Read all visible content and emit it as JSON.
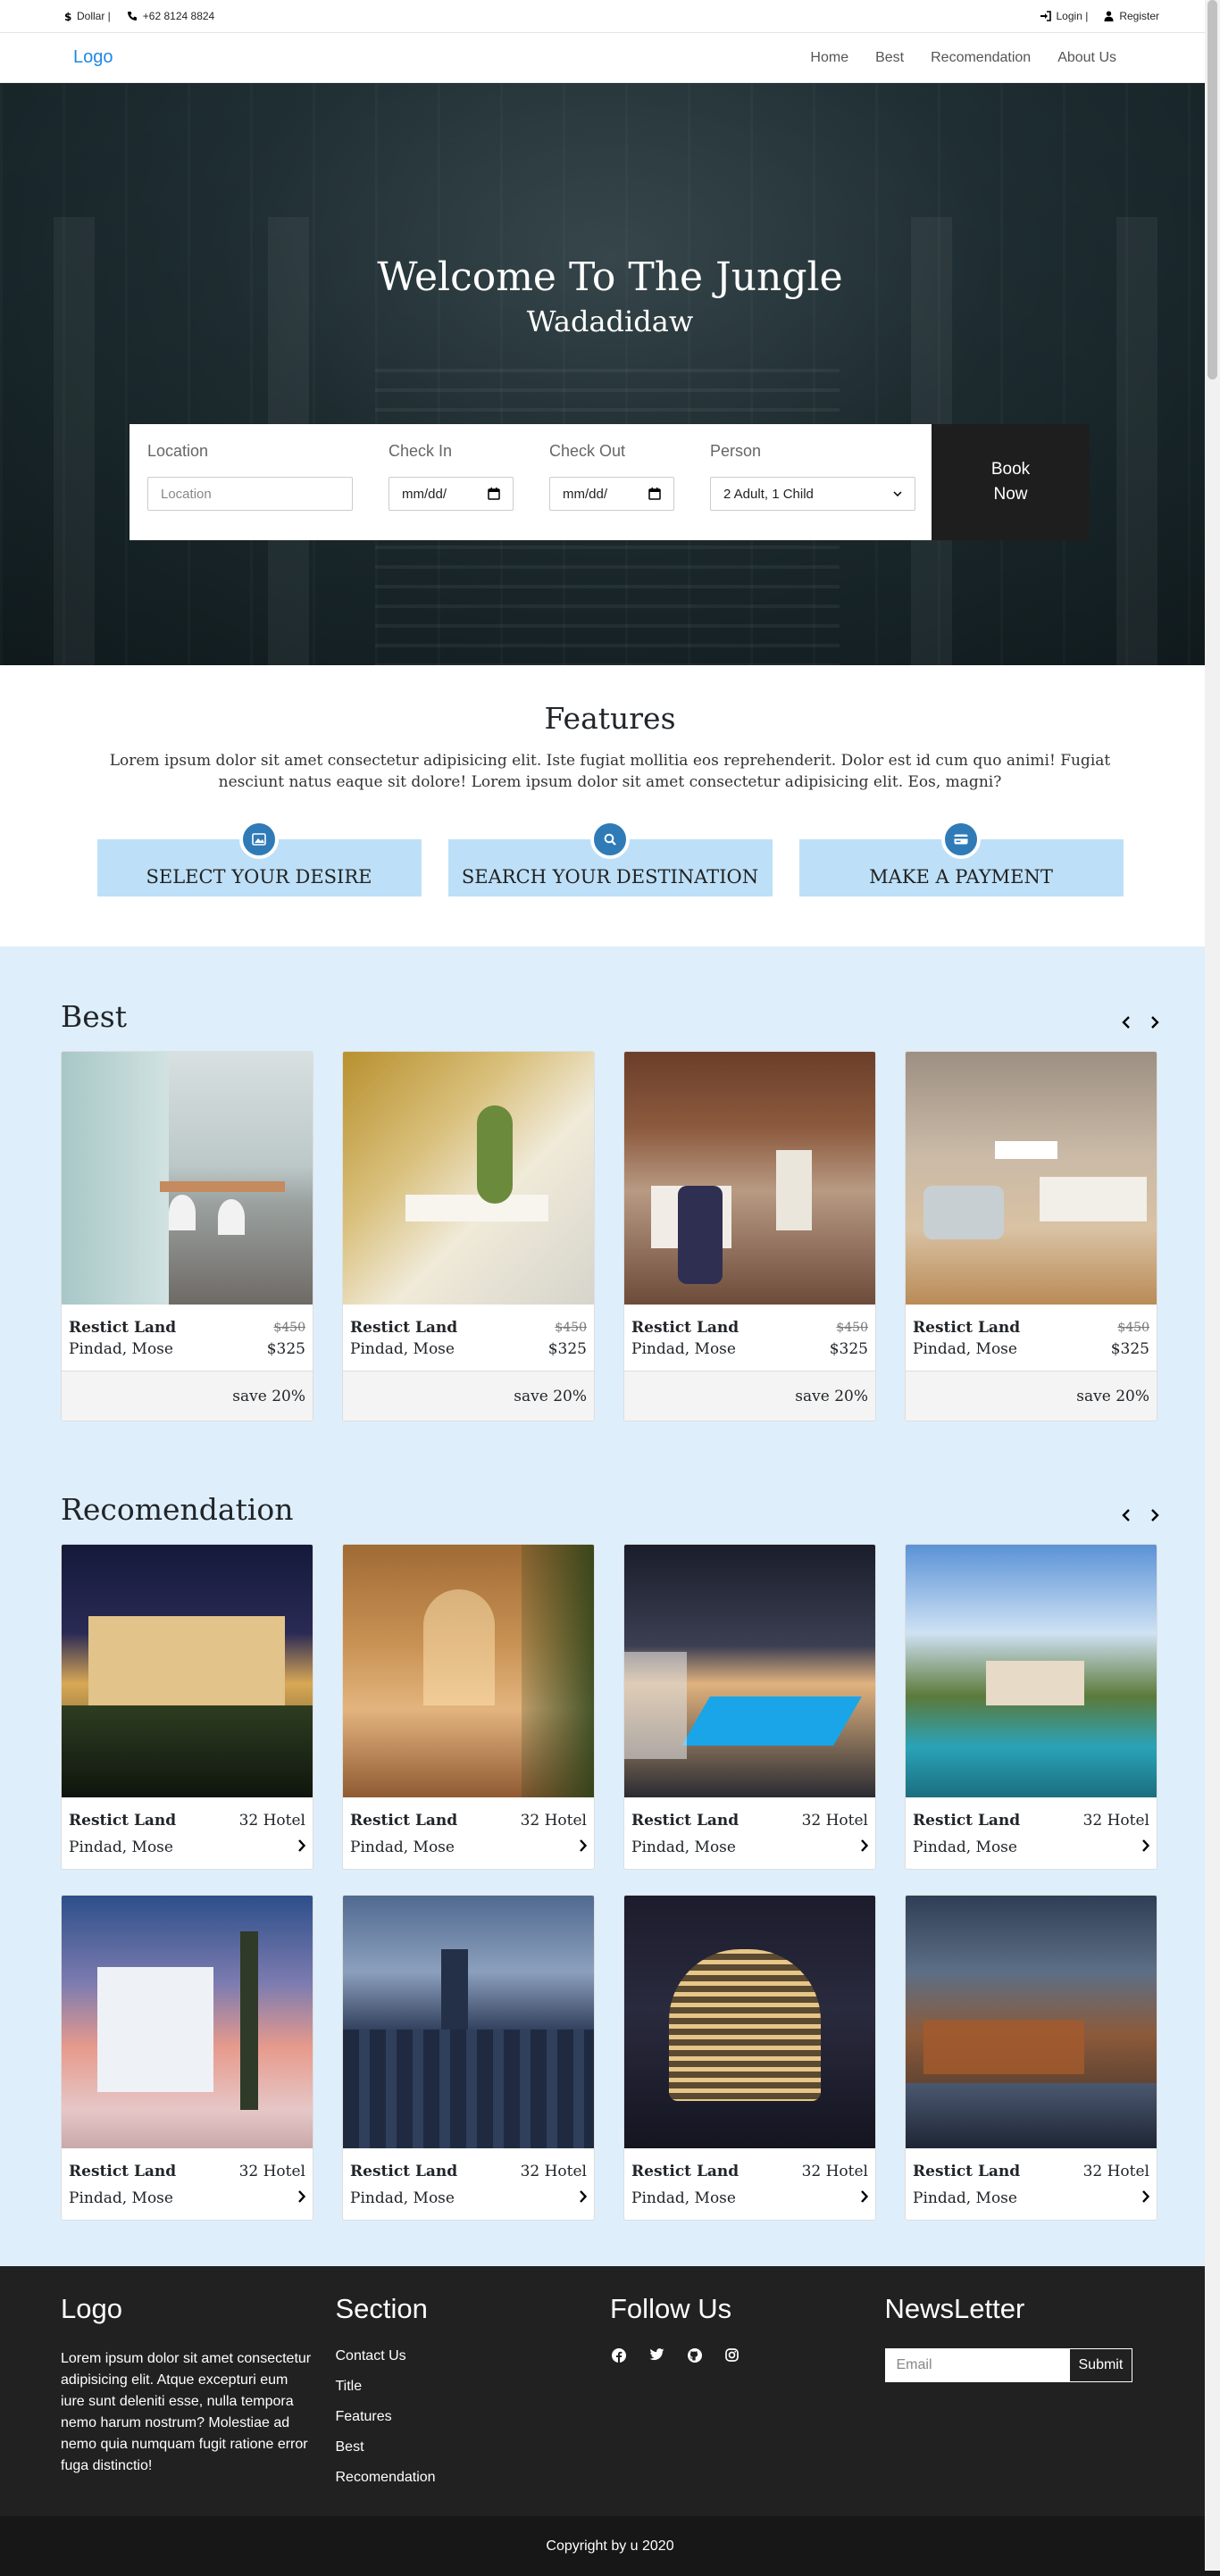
{
  "topbar": {
    "currency": "Dollar |",
    "phone": "+62 8124 8824",
    "login": "Login |",
    "register": "Register"
  },
  "nav": {
    "logo": "Logo",
    "links": [
      "Home",
      "Best",
      "Recomendation",
      "About Us"
    ]
  },
  "hero": {
    "title": "Welcome To The Jungle",
    "subtitle": "Wadadidaw"
  },
  "booking": {
    "location_label": "Location",
    "location_placeholder": "Location",
    "checkin_label": "Check In",
    "checkin_value": "mm/dd/",
    "checkout_label": "Check Out",
    "checkout_value": "mm/dd/",
    "person_label": "Person",
    "person_value": "2 Adult, 1 Child",
    "book_button": "Book Now"
  },
  "features": {
    "title": "Features",
    "text": "Lorem ipsum dolor sit amet consectetur adipisicing elit. Iste fugiat mollitia eos reprehenderit. Dolor est id cum quo animi! Fugiat nesciunt natus eaque sit dolore! Lorem ipsum dolor sit amet consectetur adipisicing elit. Eos, magni?",
    "cards": [
      "SELECT YOUR DESIRE",
      "SEARCH YOUR DESTINATION",
      "MAKE A PAYMENT"
    ]
  },
  "best": {
    "title": "Best",
    "cards": [
      {
        "name": "Restict Land",
        "location": "Pindad, Mose",
        "old_price": "$450",
        "price": "$325",
        "save": "save 20%"
      },
      {
        "name": "Restict Land",
        "location": "Pindad, Mose",
        "old_price": "$450",
        "price": "$325",
        "save": "save 20%"
      },
      {
        "name": "Restict Land",
        "location": "Pindad, Mose",
        "old_price": "$450",
        "price": "$325",
        "save": "save 20%"
      },
      {
        "name": "Restict Land",
        "location": "Pindad, Mose",
        "old_price": "$450",
        "price": "$325",
        "save": "save 20%"
      }
    ]
  },
  "recomendation": {
    "title": "Recomendation",
    "cards": [
      {
        "name": "Restict Land",
        "location": "Pindad, Mose",
        "count": "32 Hotel"
      },
      {
        "name": "Restict Land",
        "location": "Pindad, Mose",
        "count": "32 Hotel"
      },
      {
        "name": "Restict Land",
        "location": "Pindad, Mose",
        "count": "32 Hotel"
      },
      {
        "name": "Restict Land",
        "location": "Pindad, Mose",
        "count": "32 Hotel"
      },
      {
        "name": "Restict Land",
        "location": "Pindad, Mose",
        "count": "32 Hotel"
      },
      {
        "name": "Restict Land",
        "location": "Pindad, Mose",
        "count": "32 Hotel"
      },
      {
        "name": "Restict Land",
        "location": "Pindad, Mose",
        "count": "32 Hotel"
      },
      {
        "name": "Restict Land",
        "location": "Pindad, Mose",
        "count": "32 Hotel"
      }
    ]
  },
  "footer": {
    "logo": "Logo",
    "about": "Lorem ipsum dolor sit amet consectetur adipisicing elit. Atque excepturi eum iure sunt deleniti esse, nulla tempora nemo harum nostrum? Molestiae ad nemo quia numquam fugit ratione error fuga distinctio!",
    "section_title": "Section",
    "section_links": [
      "Contact Us",
      "Title",
      "Features",
      "Best",
      "Recomendation"
    ],
    "follow_title": "Follow Us",
    "social_icons": [
      "facebook-icon",
      "twitter-icon",
      "github-icon",
      "instagram-icon"
    ],
    "newsletter_title": "NewsLetter",
    "email_placeholder": "Email",
    "submit": "Submit",
    "copyright": "Copyright by u 2020"
  },
  "colors": {
    "brand_blue": "#1e88e5",
    "feature_blue": "#bde0f8",
    "section_bg": "#deeffb",
    "dark": "#212121"
  }
}
